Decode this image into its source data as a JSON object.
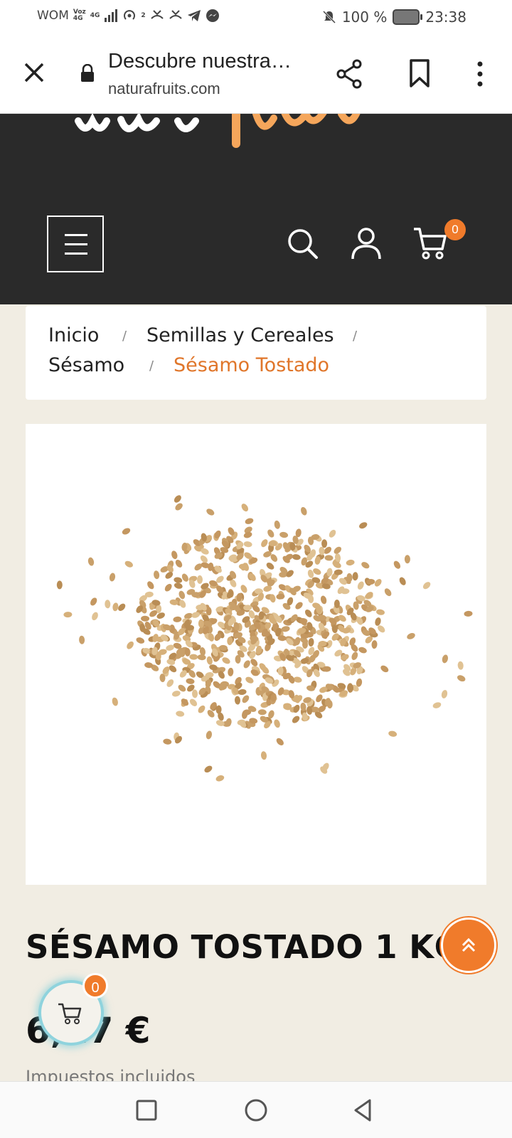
{
  "status_bar": {
    "carrier": "WOM",
    "network_a": "Voz\n4G",
    "network_b": "4G",
    "superscript": "2",
    "battery": "100 %",
    "time": "23:38",
    "icons": [
      "signal-icon",
      "hotspot-icon",
      "missed-call-icon",
      "missed-call-icon",
      "telegram-icon",
      "messenger-icon",
      "mute-icon",
      "battery-icon"
    ]
  },
  "browser": {
    "title": "Descubre nuestra…",
    "url": "naturafruits.com"
  },
  "header": {
    "cart_count": "0"
  },
  "breadcrumb": {
    "items": [
      "Inicio",
      "Semillas y Cereales",
      "Sésamo",
      "Sésamo Tostado"
    ],
    "separator": "/"
  },
  "product": {
    "title": "SÉSAMO TOSTADO 1 KG",
    "price": "6,27 €",
    "tax_note": "Impuestos incluidos",
    "image_alt": "sesame-seeds-pile"
  },
  "floating_cart": {
    "count": "0"
  },
  "colors": {
    "accent": "#f07b2b",
    "header_bg": "#2a2a2a",
    "page_bg": "#f1ede3"
  }
}
